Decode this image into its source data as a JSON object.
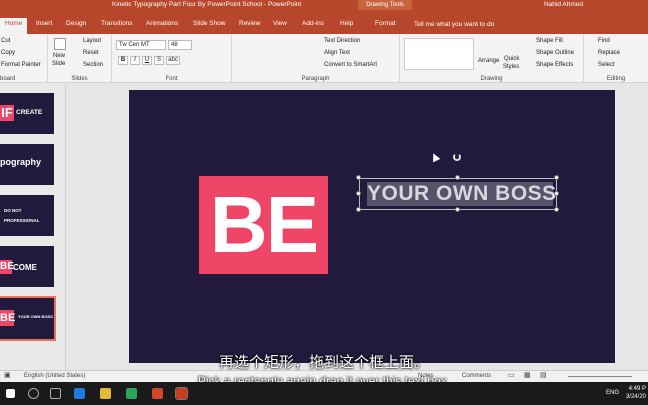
{
  "titlebar": {
    "document_title": "Kinetic Typography Part Four By PowerPoint School - PowerPoint",
    "context_tab_group": "Drawing Tools",
    "user": "Nahid Ahmed"
  },
  "tabs": {
    "items": [
      "Home",
      "Insert",
      "Design",
      "Transitions",
      "Animations",
      "Slide Show",
      "Review",
      "View",
      "Add-ins",
      "Help",
      "Format"
    ],
    "active": "Home",
    "tell_me": "Tell me what you want to do"
  },
  "ribbon": {
    "clipboard": {
      "cut": "Cut",
      "copy": "Copy",
      "format_painter": "Format Painter",
      "label": "board"
    },
    "slides": {
      "new_slide": "New",
      "new_slide_2": "Slide",
      "layout": "Layout",
      "reset": "Reset",
      "section": "Section",
      "label": "Slides"
    },
    "font": {
      "name": "Tw Cen MT",
      "size": "48",
      "bold": "B",
      "italic": "I",
      "underline": "U",
      "strike": "S",
      "shadow": "abc",
      "label": "Font"
    },
    "paragraph": {
      "text_direction": "Text Direction",
      "align_text": "Align Text",
      "smartart": "Convert to SmartArt",
      "label": "Paragraph"
    },
    "drawing": {
      "arrange": "Arrange",
      "quick_styles": "Quick",
      "quick_styles_2": "Styles",
      "shape_fill": "Shape Fill",
      "shape_outline": "Shape Outline",
      "shape_effects": "Shape Effects",
      "label": "Drawing"
    },
    "editing": {
      "find": "Find",
      "replace": "Replace",
      "select": "Select",
      "label": "Editing"
    }
  },
  "thumbnails": [
    {
      "big": "IF",
      "line1": "CREATE"
    },
    {
      "line1": "pography"
    },
    {
      "line1": "DO NOT",
      "line2": "PROFESSIONAL"
    },
    {
      "big": "BE",
      "line1": "COME"
    },
    {
      "big": "BE",
      "line1": "YOUR OWN BOSS"
    }
  ],
  "slide": {
    "big_word": "BE",
    "textbox_text": "YOUR OWN BOSS"
  },
  "subtitles": {
    "chinese": "再选个矩形，拖到这个框上面。",
    "english": "Pick a rectangle again,drag it over this text box."
  },
  "statusbar": {
    "language": "English (United States)",
    "notes": "Notes",
    "comments": "Comments"
  },
  "taskbar": {
    "lang": "ENG",
    "time": "4:49 P",
    "date": "3/24/20"
  },
  "colors": {
    "accent": "#b7472a",
    "slide_bg": "#221a3c",
    "pink": "#ef4667"
  }
}
